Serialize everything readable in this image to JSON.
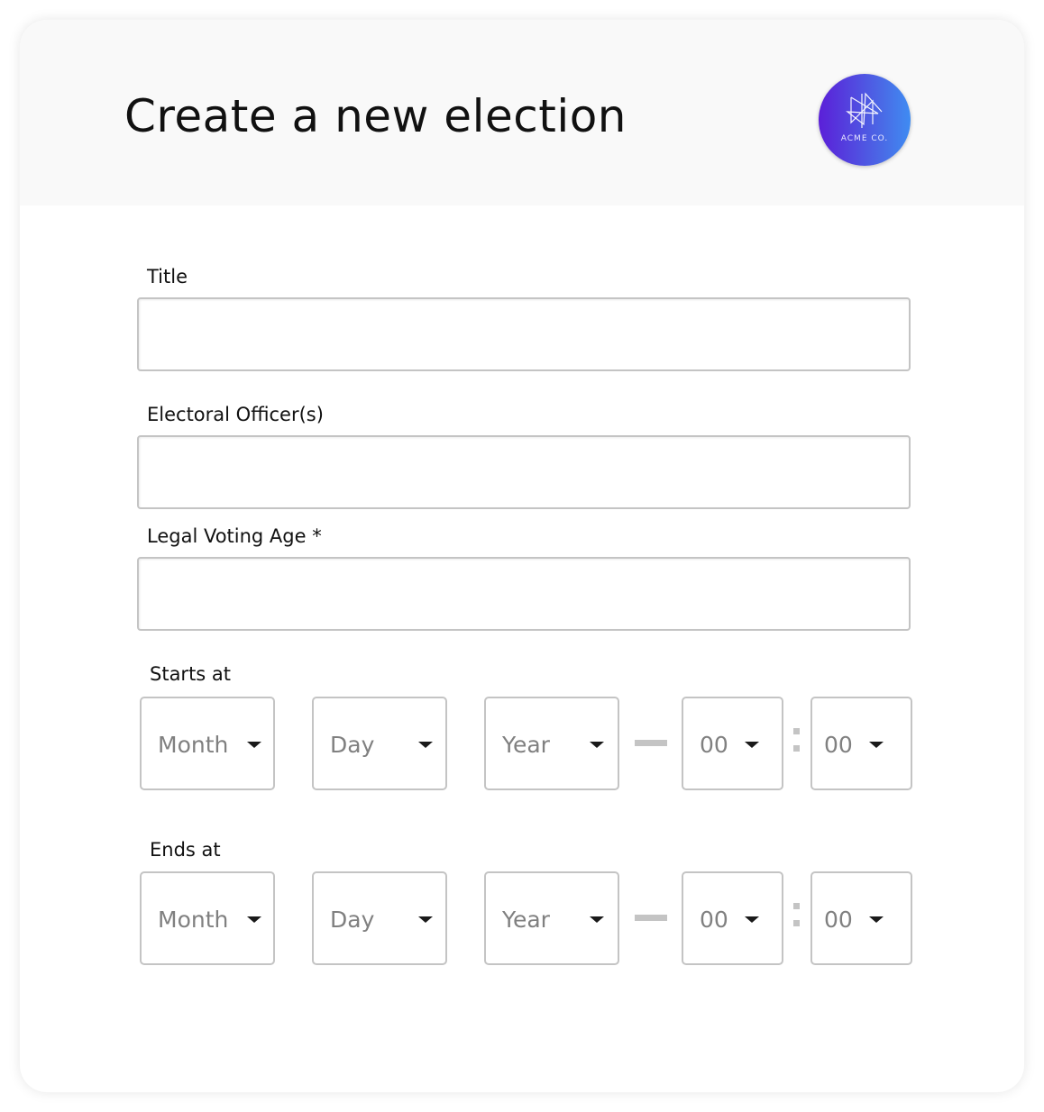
{
  "header": {
    "title": "Create a new election",
    "logo": {
      "icon": "acme-logo-icon",
      "text": "ACME CO.",
      "gradient_from": "#5b1fd8",
      "gradient_to": "#3f8cf2"
    }
  },
  "form": {
    "title": {
      "label": "Title",
      "value": "",
      "placeholder": ""
    },
    "officers": {
      "label": "Electoral Officer(s)",
      "value": "",
      "placeholder": ""
    },
    "voting_age": {
      "label": "Legal Voting Age *",
      "value": "",
      "placeholder": ""
    },
    "starts_at": {
      "label": "Starts at",
      "month": "Month",
      "day": "Day",
      "year": "Year",
      "hour": "00",
      "minute": "00",
      "date_time_separator": "dash",
      "time_separator": ":"
    },
    "ends_at": {
      "label": "Ends at",
      "month": "Month",
      "day": "Day",
      "year": "Year",
      "hour": "00",
      "minute": "00",
      "date_time_separator": "dash",
      "time_separator": ":"
    }
  },
  "colors": {
    "border": "#c4c4c4",
    "placeholder_text": "#808080",
    "header_bg": "#f9f9f9"
  }
}
